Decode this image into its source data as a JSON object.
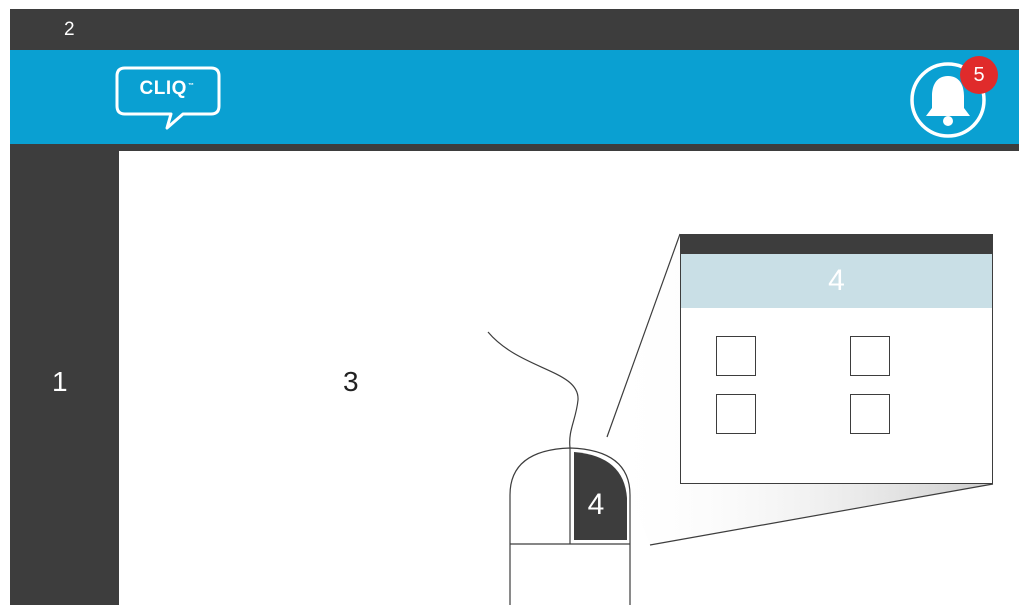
{
  "topbar": {
    "label": "2"
  },
  "header": {
    "logo_text": "CLIQ",
    "logo_tm": "™"
  },
  "notifications": {
    "count": "5"
  },
  "sidebar": {
    "label": "1"
  },
  "main": {
    "label": "3"
  },
  "popup": {
    "header_label": "4"
  },
  "mouse": {
    "button_label": "4"
  },
  "colors": {
    "dark": "#3d3d3d",
    "brand_blue": "#0aa0d2",
    "badge_red": "#e02b2b",
    "popup_header": "#c9dfe6"
  },
  "icons": {
    "logo": "speech-bubble-logo",
    "notification": "bell-icon",
    "pointer": "mouse-icon"
  }
}
